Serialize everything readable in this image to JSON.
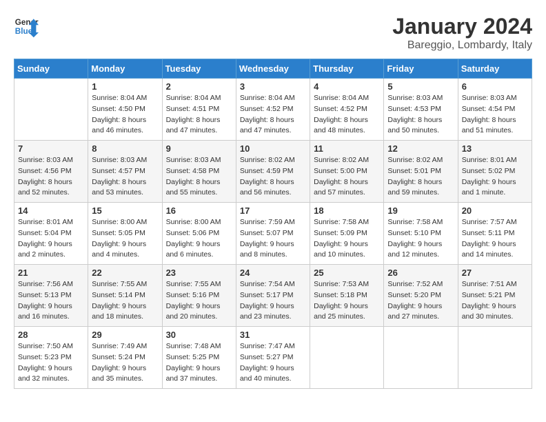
{
  "header": {
    "logo_general": "General",
    "logo_blue": "Blue",
    "month": "January 2024",
    "location": "Bareggio, Lombardy, Italy"
  },
  "days_of_week": [
    "Sunday",
    "Monday",
    "Tuesday",
    "Wednesday",
    "Thursday",
    "Friday",
    "Saturday"
  ],
  "weeks": [
    [
      {
        "day": "",
        "info": ""
      },
      {
        "day": "1",
        "info": "Sunrise: 8:04 AM\nSunset: 4:50 PM\nDaylight: 8 hours\nand 46 minutes."
      },
      {
        "day": "2",
        "info": "Sunrise: 8:04 AM\nSunset: 4:51 PM\nDaylight: 8 hours\nand 47 minutes."
      },
      {
        "day": "3",
        "info": "Sunrise: 8:04 AM\nSunset: 4:52 PM\nDaylight: 8 hours\nand 47 minutes."
      },
      {
        "day": "4",
        "info": "Sunrise: 8:04 AM\nSunset: 4:52 PM\nDaylight: 8 hours\nand 48 minutes."
      },
      {
        "day": "5",
        "info": "Sunrise: 8:03 AM\nSunset: 4:53 PM\nDaylight: 8 hours\nand 50 minutes."
      },
      {
        "day": "6",
        "info": "Sunrise: 8:03 AM\nSunset: 4:54 PM\nDaylight: 8 hours\nand 51 minutes."
      }
    ],
    [
      {
        "day": "7",
        "info": "Sunrise: 8:03 AM\nSunset: 4:56 PM\nDaylight: 8 hours\nand 52 minutes."
      },
      {
        "day": "8",
        "info": "Sunrise: 8:03 AM\nSunset: 4:57 PM\nDaylight: 8 hours\nand 53 minutes."
      },
      {
        "day": "9",
        "info": "Sunrise: 8:03 AM\nSunset: 4:58 PM\nDaylight: 8 hours\nand 55 minutes."
      },
      {
        "day": "10",
        "info": "Sunrise: 8:02 AM\nSunset: 4:59 PM\nDaylight: 8 hours\nand 56 minutes."
      },
      {
        "day": "11",
        "info": "Sunrise: 8:02 AM\nSunset: 5:00 PM\nDaylight: 8 hours\nand 57 minutes."
      },
      {
        "day": "12",
        "info": "Sunrise: 8:02 AM\nSunset: 5:01 PM\nDaylight: 8 hours\nand 59 minutes."
      },
      {
        "day": "13",
        "info": "Sunrise: 8:01 AM\nSunset: 5:02 PM\nDaylight: 9 hours\nand 1 minute."
      }
    ],
    [
      {
        "day": "14",
        "info": "Sunrise: 8:01 AM\nSunset: 5:04 PM\nDaylight: 9 hours\nand 2 minutes."
      },
      {
        "day": "15",
        "info": "Sunrise: 8:00 AM\nSunset: 5:05 PM\nDaylight: 9 hours\nand 4 minutes."
      },
      {
        "day": "16",
        "info": "Sunrise: 8:00 AM\nSunset: 5:06 PM\nDaylight: 9 hours\nand 6 minutes."
      },
      {
        "day": "17",
        "info": "Sunrise: 7:59 AM\nSunset: 5:07 PM\nDaylight: 9 hours\nand 8 minutes."
      },
      {
        "day": "18",
        "info": "Sunrise: 7:58 AM\nSunset: 5:09 PM\nDaylight: 9 hours\nand 10 minutes."
      },
      {
        "day": "19",
        "info": "Sunrise: 7:58 AM\nSunset: 5:10 PM\nDaylight: 9 hours\nand 12 minutes."
      },
      {
        "day": "20",
        "info": "Sunrise: 7:57 AM\nSunset: 5:11 PM\nDaylight: 9 hours\nand 14 minutes."
      }
    ],
    [
      {
        "day": "21",
        "info": "Sunrise: 7:56 AM\nSunset: 5:13 PM\nDaylight: 9 hours\nand 16 minutes."
      },
      {
        "day": "22",
        "info": "Sunrise: 7:55 AM\nSunset: 5:14 PM\nDaylight: 9 hours\nand 18 minutes."
      },
      {
        "day": "23",
        "info": "Sunrise: 7:55 AM\nSunset: 5:16 PM\nDaylight: 9 hours\nand 20 minutes."
      },
      {
        "day": "24",
        "info": "Sunrise: 7:54 AM\nSunset: 5:17 PM\nDaylight: 9 hours\nand 23 minutes."
      },
      {
        "day": "25",
        "info": "Sunrise: 7:53 AM\nSunset: 5:18 PM\nDaylight: 9 hours\nand 25 minutes."
      },
      {
        "day": "26",
        "info": "Sunrise: 7:52 AM\nSunset: 5:20 PM\nDaylight: 9 hours\nand 27 minutes."
      },
      {
        "day": "27",
        "info": "Sunrise: 7:51 AM\nSunset: 5:21 PM\nDaylight: 9 hours\nand 30 minutes."
      }
    ],
    [
      {
        "day": "28",
        "info": "Sunrise: 7:50 AM\nSunset: 5:23 PM\nDaylight: 9 hours\nand 32 minutes."
      },
      {
        "day": "29",
        "info": "Sunrise: 7:49 AM\nSunset: 5:24 PM\nDaylight: 9 hours\nand 35 minutes."
      },
      {
        "day": "30",
        "info": "Sunrise: 7:48 AM\nSunset: 5:25 PM\nDaylight: 9 hours\nand 37 minutes."
      },
      {
        "day": "31",
        "info": "Sunrise: 7:47 AM\nSunset: 5:27 PM\nDaylight: 9 hours\nand 40 minutes."
      },
      {
        "day": "",
        "info": ""
      },
      {
        "day": "",
        "info": ""
      },
      {
        "day": "",
        "info": ""
      }
    ]
  ]
}
